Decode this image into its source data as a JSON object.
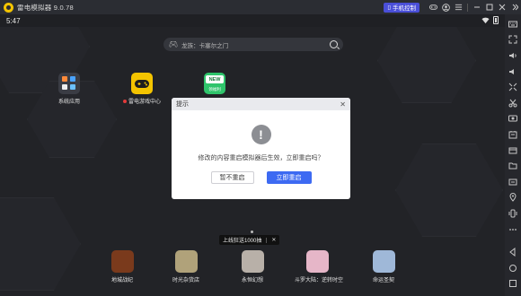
{
  "window": {
    "title": "雷电模拟器 9.0.78",
    "phone_control": "手机控制"
  },
  "status": {
    "time": "5:47"
  },
  "search": {
    "placeholder": "龙族：卡塞尔之门"
  },
  "apps": [
    {
      "label": "系统应用"
    },
    {
      "label": "雷电游戏中心"
    },
    {
      "label": "",
      "badge": "NEW",
      "sub": "领福利"
    }
  ],
  "dialog": {
    "title": "提示",
    "message": "修改的内容重启模拟器后生效，立即重启吗？",
    "cancel": "暂不重启",
    "confirm": "立即重启"
  },
  "promo": {
    "text": "上线狂送1000抽",
    "close": "✕"
  },
  "dock": [
    {
      "label": "地城战纪",
      "color": "#7a3a1c"
    },
    {
      "label": "时光杂货店",
      "color": "#b0a27a"
    },
    {
      "label": "永恒幻想",
      "color": "#b8b0a8"
    },
    {
      "label": "斗罗大陆：逆转时空",
      "color": "#e6b6c8"
    },
    {
      "label": "命运圣契",
      "color": "#9fb8d8"
    }
  ],
  "colors": {
    "accent": "#3d6af2",
    "phone_button": "#4a4fd8",
    "game_center": "#f4c400"
  }
}
